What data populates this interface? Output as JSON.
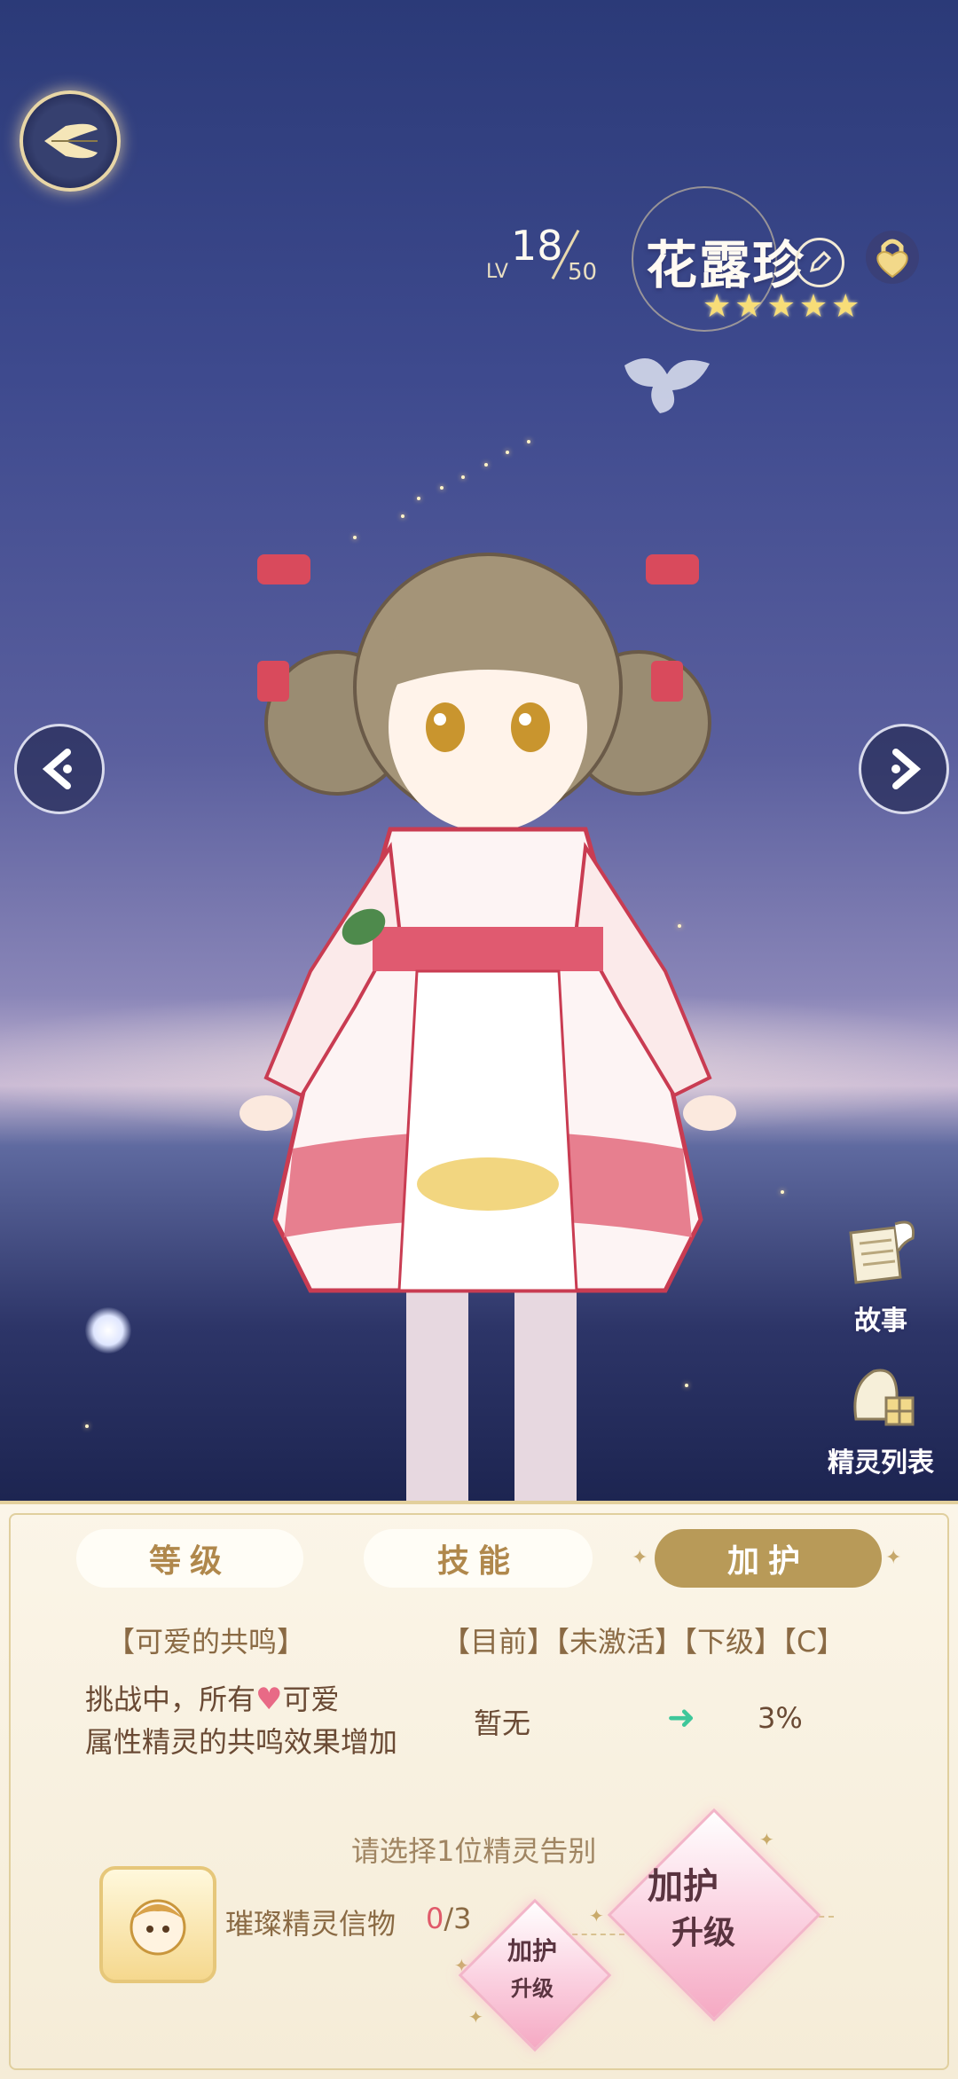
{
  "character": {
    "name": "花露珍",
    "level_label": "LV",
    "level": "18",
    "level_max": "50",
    "stars": 5
  },
  "side_buttons": {
    "story": "故事",
    "spirit_list": "精灵列表"
  },
  "tabs": {
    "level": "等级",
    "skill": "技能",
    "protect": "加护"
  },
  "protect": {
    "effect_name": "【可爱的共鸣】",
    "status_tags": "【目前】【未激活】【下级】【C】",
    "desc_line1_pre": "挑战中，所有",
    "desc_line1_post": "可爱",
    "desc_line2": "属性精灵的共鸣效果增加",
    "current_value": "暂无",
    "next_value": "3%",
    "prompt": "请选择1位精灵告别",
    "token_label": "璀璨精灵信物",
    "token_have": "0",
    "token_need": "/3",
    "btn_small_l1": "加护",
    "btn_small_l2": "升级",
    "btn_big_l1": "加护",
    "btn_big_l2": "升级"
  },
  "colors": {
    "tab_active": "#b89a58",
    "panel_bg": "#f5ecd7",
    "accent_green": "#3ec79a",
    "count_red": "#e05a6a"
  }
}
